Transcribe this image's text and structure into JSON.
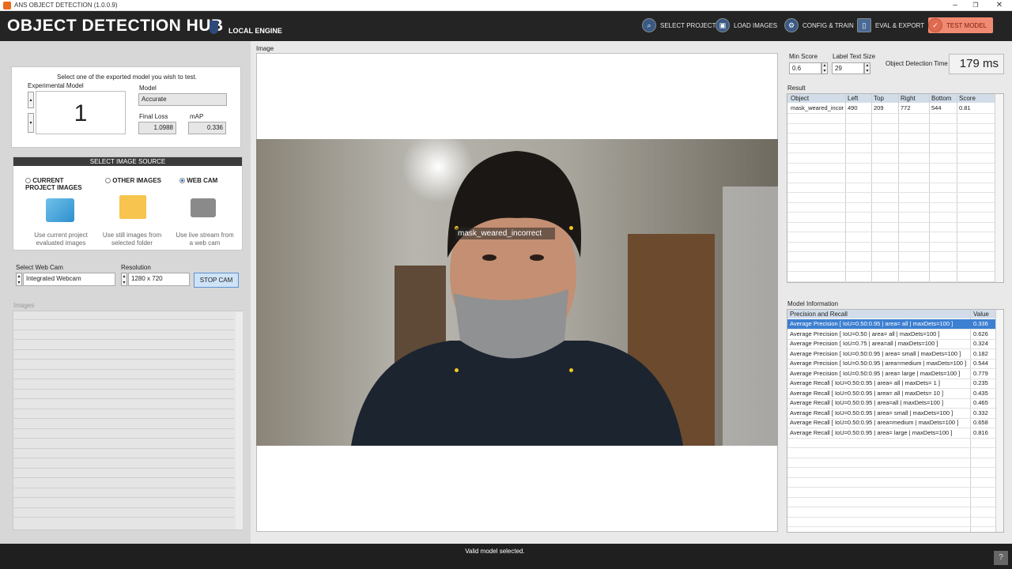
{
  "window": {
    "title": "ANS OBJECT DETECTION (1.0.0.9)",
    "minimize": "–",
    "restore": "❐",
    "close": "✕"
  },
  "header": {
    "app_title": "OBJECT DETECTION HUB",
    "engine": "LOCAL ENGINE"
  },
  "nav": [
    {
      "label": "SELECT PROJECT",
      "icon": "search-icon"
    },
    {
      "label": "LOAD IMAGES",
      "icon": "images-icon"
    },
    {
      "label": "CONFIG & TRAIN",
      "icon": "gear-icon"
    },
    {
      "label": "EVAL & EXPORT",
      "icon": "document-icon"
    },
    {
      "label": "TEST MODEL",
      "icon": "test-icon"
    }
  ],
  "model_select": {
    "instruction": "Select one of the exported model you wish to test.",
    "experimental_label": "Experimental Model",
    "experimental_value": "1",
    "model_label": "Model",
    "model_value": "Accurate",
    "final_loss_label": "Final Loss",
    "final_loss_value": "1.0988",
    "map_label": "mAP",
    "map_value": "0.336"
  },
  "image_source": {
    "title": "SELECT IMAGE SOURCE",
    "options": [
      {
        "label": "CURRENT PROJECT IMAGES",
        "desc": "Use current project evaluated images",
        "selected": false
      },
      {
        "label": "OTHER IMAGES",
        "desc": "Use still images from selected folder",
        "selected": false
      },
      {
        "label": "WEB CAM",
        "desc": "Use live stream from a web cam",
        "selected": true
      }
    ]
  },
  "webcam": {
    "select_label": "Select Web Cam",
    "select_value": "Integrated Webcam",
    "resolution_label": "Resolution",
    "resolution_value": "1280 x 720",
    "stop_button": "STOP CAM"
  },
  "images_label": "Images",
  "image_panel": {
    "label": "Image",
    "detection_label": "mask_weared_incorrect"
  },
  "controls": {
    "min_score_label": "Min Score",
    "min_score_value": "0.6",
    "label_text_size_label": "Label Text Size",
    "label_text_size_value": "29",
    "detection_time_label": "Object Detection Time",
    "detection_time_value": "179 ms"
  },
  "result": {
    "title": "Result",
    "columns": [
      "Object",
      "Left",
      "Top",
      "Right",
      "Bottom",
      "Score"
    ],
    "rows": [
      [
        "mask_weared_incor",
        "490",
        "209",
        "772",
        "544",
        "0.81"
      ]
    ]
  },
  "model_info": {
    "title": "Model Information",
    "columns": [
      "Precision and Recall",
      "Value"
    ],
    "rows": [
      [
        "Average Precision [ IoU=0.50:0.95 | area= all | maxDets=100 ]",
        "0.336"
      ],
      [
        "Average Precision [ IoU=0.50 | area= all | maxDets=100 ]",
        "0.626"
      ],
      [
        "Average Precision [ IoU=0.75 | area=all | maxDets=100 ]",
        "0.324"
      ],
      [
        "Average Precision [ IoU=0.50:0.95 | area= small | maxDets=100 ]",
        "0.182"
      ],
      [
        "Average Precision [ IoU=0.50:0.95 | area=medium | maxDets=100 ]",
        "0.544"
      ],
      [
        "Average Precision [ IoU=0.50:0.95 | area= large | maxDets=100 ]",
        "0.779"
      ],
      [
        "Average Recall [ IoU=0.50:0.95 | area= all | maxDets= 1 ]",
        "0.235"
      ],
      [
        "Average Recall [ IoU=0.50:0.95 | area= all | maxDets= 10 ]",
        "0.435"
      ],
      [
        "Average Recall [ IoU=0.50:0.95 | area=all | maxDets=100 ]",
        "0.465"
      ],
      [
        "Average Recall [ IoU=0.50:0.95 | area= small | maxDets=100 ]",
        "0.332"
      ],
      [
        "Average Recall [ IoU=0.50:0.95 | area=medium | maxDets=100 ]",
        "0.658"
      ],
      [
        "Average Recall [ IoU=0.50:0.95 | area= large | maxDets=100 ]",
        "0.816"
      ]
    ]
  },
  "status": {
    "message": "Valid model selected.",
    "help": "?"
  },
  "colors": {
    "header_bg": "#242424",
    "active_nav": "#f08a72",
    "selected_row": "#3d7fd1",
    "grid_header": "#d2dde9",
    "detection_point": "#f2c81f"
  }
}
